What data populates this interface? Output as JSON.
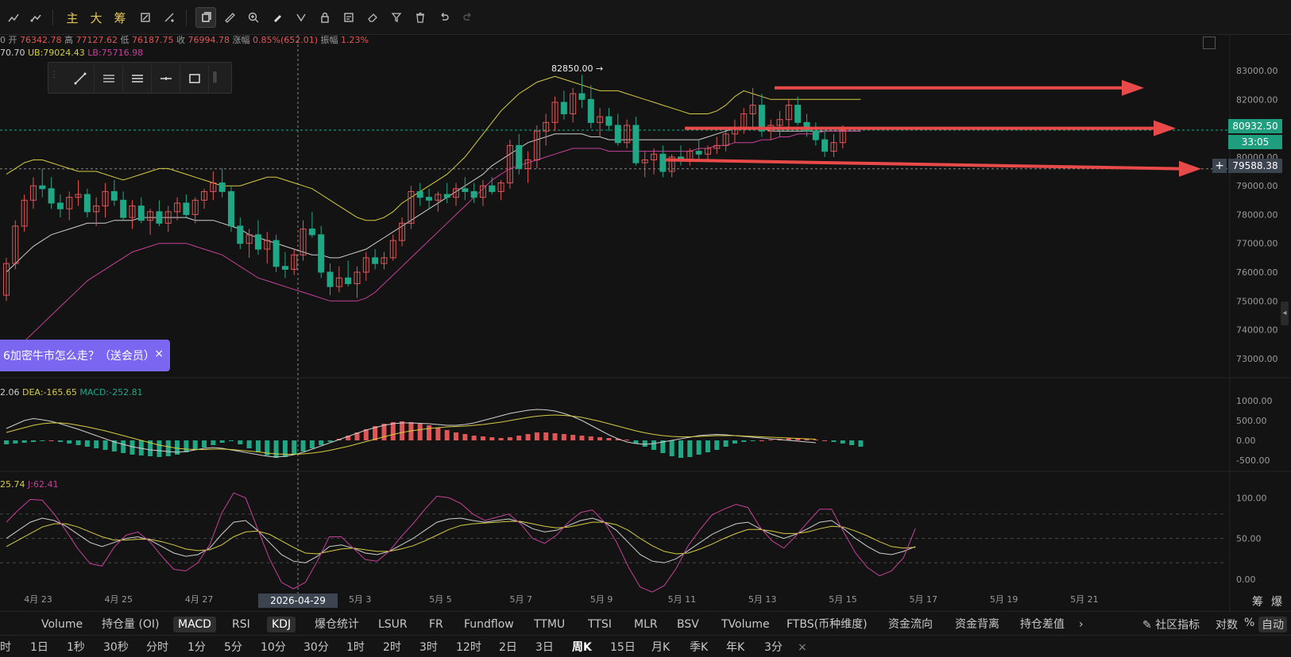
{
  "toolbar": {
    "items": [
      "主",
      "大",
      "筹"
    ]
  },
  "ohlc": {
    "open_label": "开",
    "open": "76342.78",
    "high_label": "高",
    "high": "77127.62",
    "low_label": "低",
    "low": "76187.75",
    "close_label": "收",
    "close": "76994.78",
    "chg_label": "涨幅",
    "chg": "0.85%(652.01)",
    "amp_label": "振幅",
    "amp": "1.23%",
    "prefix": "0"
  },
  "boll": {
    "mid": "70.70",
    "ub": "UB:79024.43",
    "lb": "LB:75716.98"
  },
  "promo": {
    "text": "6加密牛市怎么走？（送会员）",
    "close": "×"
  },
  "macd": {
    "dif": "2.06",
    "dea": "DEA:-165.65",
    "macd": "MACD:-252.81"
  },
  "kdj": {
    "d": "25.74",
    "j": "J:62.41"
  },
  "badges": {
    "last_price": "80932.50",
    "timer": "33:05",
    "cross_price": "79588.38",
    "cross_date": "2026-04-29 08:00",
    "plus": "+"
  },
  "peak_label": "82850.00 →",
  "indicator_tabs": [
    "Volume",
    "持仓量 (OI)",
    "MACD",
    "RSI",
    "KDJ",
    "爆仓统计",
    "LSUR",
    "FR",
    "Fundflow",
    "TTMU",
    "TTSI",
    "MLR",
    "BSV",
    "TVolume",
    "FTBS(币种维度)",
    "资金流向",
    "资金背离",
    "持仓差值"
  ],
  "indicator_more": "›",
  "right_controls": {
    "community": "社区指标",
    "log": "对数",
    "pct": "%",
    "auto": "自动"
  },
  "corner_labels": {
    "chip": "筹",
    "burst": "爆"
  },
  "timeframes": [
    "时",
    "1日",
    "1秒",
    "30秒",
    "分时",
    "1分",
    "5分",
    "10分",
    "30分",
    "1时",
    "2时",
    "3时",
    "12时",
    "2日",
    "3日",
    "周K",
    "15日",
    "月K",
    "季K",
    "年K",
    "3分"
  ],
  "timeframe_close": "×",
  "colors": {
    "bg": "#131313",
    "up": "#e05656",
    "down": "#1fa886",
    "upper_band": "#d6cc43",
    "lower_band": "#c7409a",
    "mid_band": "#cfcfcf",
    "arrow": "#e84a4a",
    "purple": "#7a66f0"
  },
  "chart_data": {
    "type": "candlestick",
    "x_ticks": [
      "4月 23",
      "4月 25",
      "4月 27",
      "5月 1",
      "5月 3",
      "5月 5",
      "5月 7",
      "5月 9",
      "5月 11",
      "5月 13",
      "5月 15",
      "5月 17",
      "5月 19",
      "5月 21"
    ],
    "y_ticks": [
      "83000.00",
      "82000.00",
      "81000.00",
      "80000.00",
      "79000.00",
      "78000.00",
      "77000.00",
      "76000.00",
      "75000.00",
      "74000.00",
      "73000.00"
    ],
    "ylim": [
      72500,
      83800
    ],
    "x_range": [
      "2026-04-22",
      "2026-05-22"
    ],
    "candles": [
      [
        75200,
        76500,
        75000,
        76300
      ],
      [
        76300,
        77800,
        76100,
        77600
      ],
      [
        77600,
        78700,
        77400,
        78500
      ],
      [
        78500,
        79300,
        78200,
        79000
      ],
      [
        79000,
        79600,
        78600,
        78900
      ],
      [
        78900,
        79300,
        78200,
        78400
      ],
      [
        78400,
        78700,
        77900,
        78200
      ],
      [
        78200,
        78800,
        77800,
        78600
      ],
      [
        78600,
        79200,
        78300,
        78700
      ],
      [
        78700,
        78900,
        77900,
        78100
      ],
      [
        78100,
        78600,
        77600,
        78300
      ],
      [
        78300,
        79100,
        77900,
        78800
      ],
      [
        78800,
        79200,
        78300,
        78500
      ],
      [
        78500,
        78800,
        77800,
        77900
      ],
      [
        77900,
        78500,
        77500,
        78300
      ],
      [
        78300,
        78600,
        77700,
        77800
      ],
      [
        77800,
        78200,
        77300,
        78100
      ],
      [
        78100,
        78500,
        77600,
        77700
      ],
      [
        77700,
        78300,
        77400,
        78100
      ],
      [
        78100,
        78600,
        77800,
        78400
      ],
      [
        78400,
        78700,
        77900,
        78000
      ],
      [
        78000,
        78600,
        77700,
        78500
      ],
      [
        78500,
        78900,
        78200,
        78800
      ],
      [
        78800,
        79500,
        78500,
        79100
      ],
      [
        79100,
        79600,
        78600,
        78800
      ],
      [
        78800,
        79000,
        77400,
        77600
      ],
      [
        77600,
        77900,
        76800,
        77000
      ],
      [
        77000,
        77500,
        76500,
        77300
      ],
      [
        77300,
        77800,
        76600,
        76800
      ],
      [
        76800,
        77400,
        76300,
        77100
      ],
      [
        77100,
        77300,
        76000,
        76200
      ],
      [
        76200,
        76700,
        75800,
        76100
      ],
      [
        76100,
        76800,
        75900,
        76600
      ],
      [
        76600,
        77800,
        76400,
        77500
      ],
      [
        77500,
        78100,
        77200,
        77300
      ],
      [
        77300,
        77600,
        75800,
        76000
      ],
      [
        76000,
        76300,
        75200,
        75500
      ],
      [
        75500,
        76200,
        75300,
        75800
      ],
      [
        75800,
        76400,
        75500,
        75600
      ],
      [
        75600,
        76200,
        75100,
        76000
      ],
      [
        76000,
        76700,
        75700,
        76500
      ],
      [
        76500,
        76800,
        76100,
        76300
      ],
      [
        76300,
        76700,
        76100,
        76500
      ],
      [
        76500,
        77300,
        76400,
        77100
      ],
      [
        77100,
        77900,
        76900,
        77700
      ],
      [
        77700,
        79000,
        77500,
        78800
      ],
      [
        78800,
        79100,
        78300,
        78600
      ],
      [
        78600,
        78900,
        78200,
        78500
      ],
      [
        78500,
        78800,
        78100,
        78700
      ],
      [
        78700,
        79100,
        78400,
        78600
      ],
      [
        78600,
        79100,
        78300,
        78900
      ],
      [
        78900,
        79300,
        78500,
        78800
      ],
      [
        78800,
        79100,
        78400,
        78600
      ],
      [
        78600,
        79200,
        78300,
        79000
      ],
      [
        79000,
        79300,
        78700,
        78800
      ],
      [
        78800,
        79200,
        78500,
        79100
      ],
      [
        79100,
        80600,
        78900,
        80400
      ],
      [
        80400,
        80800,
        79400,
        79600
      ],
      [
        79600,
        80200,
        79100,
        79900
      ],
      [
        79900,
        81100,
        79600,
        80900
      ],
      [
        80900,
        81500,
        80400,
        81200
      ],
      [
        81200,
        82100,
        80900,
        81900
      ],
      [
        81900,
        82300,
        81300,
        81500
      ],
      [
        81500,
        82400,
        81200,
        82200
      ],
      [
        82200,
        82850,
        81700,
        82000
      ],
      [
        82000,
        82500,
        81000,
        81200
      ],
      [
        81200,
        81700,
        80700,
        81400
      ],
      [
        81400,
        81700,
        80900,
        81100
      ],
      [
        81100,
        81500,
        80400,
        80500
      ],
      [
        80500,
        81300,
        80300,
        81100
      ],
      [
        81100,
        81400,
        79700,
        79800
      ],
      [
        79800,
        80200,
        79300,
        79900
      ],
      [
        79900,
        80300,
        79400,
        80100
      ],
      [
        80100,
        80400,
        79300,
        79500
      ],
      [
        79500,
        80100,
        79300,
        80000
      ],
      [
        80000,
        80400,
        79700,
        79900
      ],
      [
        79900,
        80300,
        79700,
        80200
      ],
      [
        80200,
        80600,
        79900,
        80100
      ],
      [
        80100,
        80400,
        79900,
        80300
      ],
      [
        80300,
        80700,
        80100,
        80400
      ],
      [
        80400,
        80900,
        80200,
        80800
      ],
      [
        80800,
        81300,
        80500,
        81000
      ],
      [
        81000,
        81700,
        80800,
        81500
      ],
      [
        81500,
        82400,
        81000,
        81800
      ],
      [
        81800,
        82200,
        80700,
        80900
      ],
      [
        80900,
        81300,
        80600,
        81100
      ],
      [
        81100,
        81600,
        80700,
        81300
      ],
      [
        81300,
        82000,
        81000,
        81800
      ],
      [
        81800,
        82100,
        81100,
        81200
      ],
      [
        81200,
        81500,
        80700,
        80900
      ],
      [
        80900,
        81200,
        80400,
        80600
      ],
      [
        80600,
        80900,
        80000,
        80200
      ],
      [
        80200,
        80800,
        80000,
        80500
      ],
      [
        80500,
        81100,
        80300,
        80932.5
      ]
    ],
    "band_upper": [
      79400,
      79600,
      79800,
      79900,
      79900,
      79800,
      79700,
      79600,
      79500,
      79500,
      79500,
      79400,
      79300,
      79200,
      79300,
      79400,
      79500,
      79600,
      79600,
      79500,
      79400,
      79300,
      79200,
      79100,
      79000,
      79000,
      79000,
      79100,
      79200,
      79300,
      79300,
      79200,
      79100,
      79000,
      78900,
      78700,
      78500,
      78300,
      78100,
      77900,
      77800,
      77800,
      77900,
      78100,
      78400,
      78600,
      78800,
      79000,
      79200,
      79400,
      79700,
      80000,
      80400,
      80800,
      81200,
      81600,
      81900,
      82200,
      82400,
      82600,
      82700,
      82800,
      82700,
      82600,
      82500,
      82400,
      82300,
      82300,
      82300,
      82200,
      82100,
      82000,
      81900,
      81800,
      81700,
      81600,
      81500,
      81500,
      81500,
      81600,
      81800,
      82100,
      82300,
      82200,
      82100,
      82000,
      82000,
      82000,
      82000,
      82000,
      82000,
      82000,
      82000,
      82000,
      82000,
      82000
    ],
    "band_mid": [
      76000,
      76300,
      76600,
      76900,
      77100,
      77300,
      77400,
      77500,
      77600,
      77700,
      77700,
      77700,
      77800,
      77800,
      77800,
      77900,
      77900,
      77900,
      77900,
      77900,
      77900,
      77800,
      77800,
      77800,
      77700,
      77600,
      77500,
      77300,
      77200,
      77100,
      77000,
      76900,
      76800,
      76700,
      76600,
      76600,
      76500,
      76500,
      76600,
      76700,
      76800,
      77000,
      77200,
      77400,
      77600,
      77800,
      78000,
      78200,
      78400,
      78600,
      78800,
      79000,
      79200,
      79400,
      79700,
      79900,
      80100,
      80300,
      80500,
      80600,
      80700,
      80800,
      80800,
      80800,
      80800,
      80700,
      80700,
      80600,
      80600,
      80600,
      80600,
      80600,
      80600,
      80600,
      80600,
      80600,
      80600,
      80600,
      80700,
      80800,
      80900,
      81000,
      81000,
      81000,
      81000,
      80900,
      80900,
      80900,
      80900,
      80900,
      80900,
      80900,
      80900,
      80900,
      80900,
      80900
    ],
    "band_lower": [
      73000,
      73300,
      73600,
      73900,
      74200,
      74500,
      74800,
      75100,
      75400,
      75700,
      75900,
      76100,
      76300,
      76500,
      76700,
      76800,
      76900,
      77000,
      77000,
      77000,
      77000,
      76900,
      76800,
      76700,
      76600,
      76400,
      76200,
      76000,
      75800,
      75700,
      75600,
      75500,
      75400,
      75300,
      75200,
      75100,
      75000,
      75000,
      75000,
      75000,
      75100,
      75300,
      75600,
      75900,
      76200,
      76500,
      76800,
      77100,
      77400,
      77700,
      78000,
      78300,
      78600,
      78900,
      79200,
      79400,
      79600,
      79700,
      79800,
      79900,
      80000,
      80100,
      80200,
      80300,
      80300,
      80300,
      80300,
      80200,
      80200,
      80200,
      80200,
      80200,
      80200,
      80200,
      80200,
      80200,
      80200,
      80300,
      80300,
      80400,
      80400,
      80500,
      80500,
      80500,
      80600,
      80600,
      80700,
      80700,
      80800,
      80800,
      80800,
      80900,
      80900,
      80900,
      80900,
      80900
    ],
    "arrows": [
      [
        82400,
        82400
      ],
      [
        81000,
        81000
      ],
      [
        79900,
        79588.38
      ]
    ],
    "macd_ticks": [
      "1000.00",
      "500.00",
      "0.00",
      "-500.00"
    ],
    "macd_ylim": [
      -700,
      1100
    ],
    "macd_hist": [
      -100,
      -80,
      -60,
      -40,
      -20,
      0,
      -40,
      -80,
      -120,
      -160,
      -200,
      -240,
      -280,
      -320,
      -360,
      -380,
      -400,
      -420,
      -400,
      -360,
      -300,
      -240,
      -180,
      -120,
      -60,
      -20,
      -100,
      -200,
      -300,
      -380,
      -440,
      -420,
      -360,
      -280,
      -200,
      -120,
      -40,
      40,
      120,
      200,
      280,
      360,
      420,
      460,
      480,
      460,
      420,
      380,
      320,
      260,
      200,
      160,
      120,
      100,
      80,
      60,
      80,
      120,
      160,
      200,
      200,
      180,
      160,
      140,
      120,
      100,
      80,
      60,
      40,
      20,
      -80,
      -160,
      -240,
      -320,
      -400,
      -440,
      -420,
      -360,
      -300,
      -240,
      -160,
      -80,
      -40,
      -20,
      0,
      20,
      40,
      60,
      60,
      40,
      20,
      0,
      -40,
      -80,
      -120,
      -160
    ],
    "macd_dif": [
      300,
      400,
      500,
      550,
      520,
      480,
      420,
      350,
      280,
      200,
      120,
      40,
      -40,
      -100,
      -160,
      -200,
      -240,
      -260,
      -280,
      -300,
      -280,
      -240,
      -200,
      -180,
      -200,
      -240,
      -280,
      -320,
      -360,
      -400,
      -420,
      -400,
      -360,
      -300,
      -220,
      -140,
      -60,
      20,
      100,
      180,
      260,
      320,
      380,
      420,
      440,
      440,
      430,
      420,
      400,
      380,
      380,
      400,
      440,
      500,
      560,
      620,
      680,
      720,
      760,
      780,
      770,
      740,
      680,
      600,
      500,
      380,
      260,
      140,
      40,
      -40,
      -80,
      -100,
      -80,
      -40,
      0,
      40,
      80,
      120,
      140,
      150,
      140,
      120,
      100,
      80,
      60,
      40,
      20,
      0,
      -20,
      -40,
      -60
    ],
    "macd_dea": [
      200,
      260,
      320,
      380,
      420,
      440,
      440,
      420,
      380,
      340,
      290,
      240,
      180,
      120,
      60,
      0,
      -60,
      -120,
      -160,
      -200,
      -220,
      -230,
      -230,
      -220,
      -220,
      -230,
      -250,
      -270,
      -290,
      -320,
      -340,
      -350,
      -350,
      -340,
      -320,
      -290,
      -250,
      -200,
      -150,
      -90,
      -30,
      30,
      90,
      150,
      200,
      240,
      270,
      300,
      320,
      340,
      350,
      360,
      380,
      400,
      430,
      460,
      500,
      540,
      580,
      610,
      630,
      640,
      630,
      610,
      580,
      530,
      480,
      420,
      360,
      300,
      240,
      190,
      150,
      120,
      100,
      90,
      90,
      100,
      110,
      120,
      120,
      120,
      110,
      100,
      90,
      80,
      70,
      60,
      50,
      40,
      30
    ],
    "kdj_ticks": [
      "100.00",
      "50.00",
      "0.00"
    ],
    "kdj_ylim": [
      -10,
      115
    ],
    "kdj_k": [
      50,
      60,
      70,
      75,
      72,
      65,
      55,
      45,
      40,
      45,
      50,
      52,
      48,
      40,
      32,
      28,
      30,
      38,
      55,
      70,
      72,
      60,
      45,
      30,
      22,
      20,
      28,
      40,
      42,
      38,
      32,
      30,
      34,
      42,
      50,
      60,
      70,
      74,
      75,
      72,
      70,
      72,
      74,
      70,
      62,
      58,
      60,
      66,
      72,
      75,
      70,
      60,
      45,
      30,
      22,
      20,
      25,
      35,
      45,
      55,
      62,
      68,
      70,
      62,
      55,
      50,
      55,
      62,
      70,
      72,
      62,
      50,
      40,
      32,
      30,
      34,
      40
    ],
    "kdj_d": [
      40,
      48,
      56,
      64,
      68,
      68,
      64,
      58,
      52,
      48,
      48,
      49,
      49,
      46,
      42,
      37,
      35,
      36,
      42,
      52,
      58,
      59,
      55,
      47,
      39,
      32,
      31,
      34,
      37,
      38,
      36,
      34,
      34,
      37,
      41,
      47,
      54,
      61,
      66,
      68,
      69,
      70,
      71,
      71,
      68,
      65,
      63,
      64,
      67,
      70,
      70,
      67,
      60,
      50,
      41,
      34,
      31,
      32,
      37,
      43,
      50,
      56,
      61,
      61,
      59,
      56,
      56,
      58,
      62,
      65,
      64,
      59,
      53,
      46,
      40,
      38,
      39
    ],
    "kdj_j": [
      70,
      85,
      98,
      97,
      80,
      59,
      37,
      19,
      16,
      39,
      54,
      58,
      46,
      28,
      12,
      10,
      20,
      42,
      81,
      106,
      100,
      62,
      25,
      -4,
      -12,
      -4,
      22,
      52,
      52,
      38,
      24,
      22,
      34,
      52,
      68,
      86,
      102,
      100,
      93,
      80,
      72,
      76,
      80,
      68,
      50,
      44,
      54,
      70,
      82,
      85,
      70,
      46,
      15,
      -10,
      -16,
      -8,
      13,
      41,
      61,
      79,
      86,
      92,
      88,
      64,
      47,
      38,
      53,
      70,
      86,
      86,
      58,
      32,
      14,
      4,
      10,
      26,
      62.41
    ]
  }
}
